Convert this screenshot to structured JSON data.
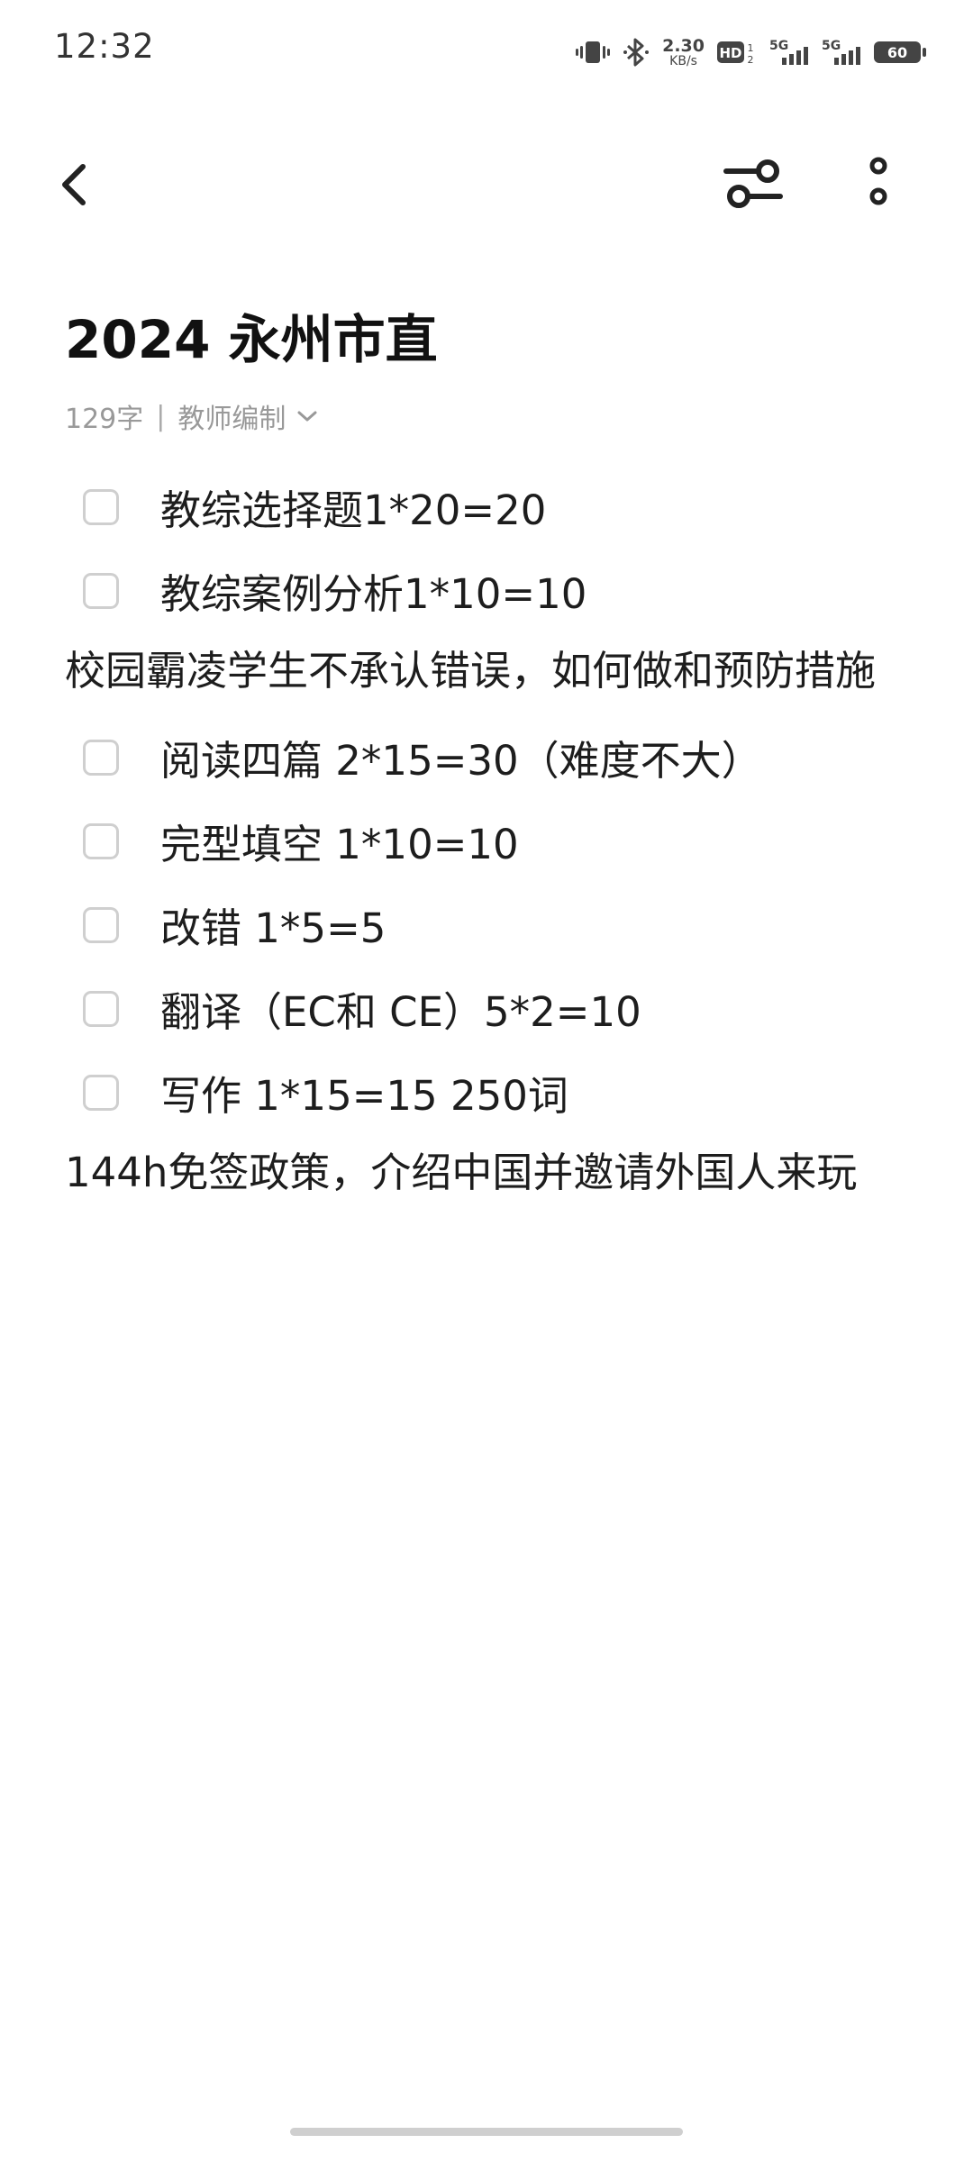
{
  "status_bar": {
    "time": "12:32",
    "net_speed_value": "2.30",
    "net_speed_unit": "KB/s",
    "hd_label": "HD",
    "sim1_label": "5G",
    "sim2_label": "5G",
    "battery_level": "60",
    "icons": [
      "vibrate-icon",
      "bluetooth-icon",
      "hd-voice-icon",
      "signal-icon",
      "battery-icon"
    ]
  },
  "app_bar": {
    "back_icon": "chevron-left-icon",
    "filter_icon": "sliders-icon",
    "more_icon": "more-vertical-icon"
  },
  "note": {
    "title": "2024 永州市直",
    "word_count": "129字",
    "separator": "|",
    "category": "教师编制",
    "blocks": [
      {
        "type": "check",
        "text": "教综选择题1*20=20",
        "checked": false
      },
      {
        "type": "check",
        "text": "教综案例分析1*10=10",
        "checked": false
      },
      {
        "type": "text",
        "text": "校园霸凌学生不承认错误，如何做和预防措施"
      },
      {
        "type": "check",
        "text": "阅读四篇 2*15=30（难度不大）",
        "checked": false
      },
      {
        "type": "check",
        "text": "完型填空 1*10=10",
        "checked": false
      },
      {
        "type": "check",
        "text": "改错 1*5=5",
        "checked": false
      },
      {
        "type": "check",
        "text": "翻译（EC和 CE）5*2=10",
        "checked": false
      },
      {
        "type": "check",
        "text": "写作 1*15=15 250词",
        "checked": false
      },
      {
        "type": "text",
        "text": "144h免签政策，介绍中国并邀请外国人来玩"
      }
    ]
  },
  "colors": {
    "background": "#ffffff",
    "text": "#1d1d1d",
    "muted": "#999999",
    "checkbox_border": "#cfcfcf"
  }
}
